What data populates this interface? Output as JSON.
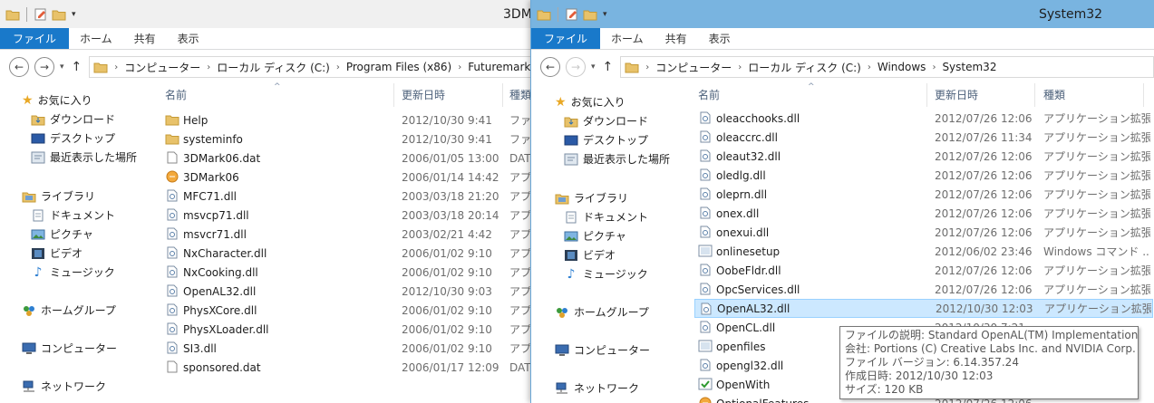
{
  "left_window": {
    "title": "3DM",
    "ribbon_tabs": [
      "ファイル",
      "ホーム",
      "共有",
      "表示"
    ],
    "breadcrumb": [
      "コンピューター",
      "ローカル ディスク (C:)",
      "Program Files (x86)",
      "Futuremark"
    ],
    "columns": {
      "name": "名前",
      "date": "更新日時",
      "type": "種類"
    },
    "nav": {
      "favorites": "お気に入り",
      "downloads": "ダウンロード",
      "desktop": "デスクトップ",
      "recent": "最近表示した場所",
      "libraries": "ライブラリ",
      "documents": "ドキュメント",
      "pictures": "ピクチャ",
      "videos": "ビデオ",
      "music": "ミュージック",
      "homegroup": "ホームグループ",
      "computer": "コンピューター",
      "network": "ネットワーク"
    },
    "files": [
      {
        "name": "Help",
        "date": "2012/10/30 9:41",
        "type": "ファイ",
        "icon": "folder"
      },
      {
        "name": "systeminfo",
        "date": "2012/10/30 9:41",
        "type": "ファイ",
        "icon": "folder"
      },
      {
        "name": "3DMark06.dat",
        "date": "2006/01/05 13:00",
        "type": "DAT",
        "icon": "file"
      },
      {
        "name": "3DMark06",
        "date": "2006/01/14 14:42",
        "type": "アプリ",
        "icon": "app"
      },
      {
        "name": "MFC71.dll",
        "date": "2003/03/18 21:20",
        "type": "アプリ",
        "icon": "dll"
      },
      {
        "name": "msvcp71.dll",
        "date": "2003/03/18 20:14",
        "type": "アプリ",
        "icon": "dll"
      },
      {
        "name": "msvcr71.dll",
        "date": "2003/02/21 4:42",
        "type": "アプリ",
        "icon": "dll"
      },
      {
        "name": "NxCharacter.dll",
        "date": "2006/01/02 9:10",
        "type": "アプリ",
        "icon": "dll"
      },
      {
        "name": "NxCooking.dll",
        "date": "2006/01/02 9:10",
        "type": "アプリ",
        "icon": "dll"
      },
      {
        "name": "OpenAL32.dll",
        "date": "2012/10/30 9:03",
        "type": "アプリ",
        "icon": "dll"
      },
      {
        "name": "PhysXCore.dll",
        "date": "2006/01/02 9:10",
        "type": "アプリ",
        "icon": "dll"
      },
      {
        "name": "PhysXLoader.dll",
        "date": "2006/01/02 9:10",
        "type": "アプリ",
        "icon": "dll"
      },
      {
        "name": "SI3.dll",
        "date": "2006/01/02 9:10",
        "type": "アプリ",
        "icon": "dll"
      },
      {
        "name": "sponsored.dat",
        "date": "2006/01/17 12:09",
        "type": "DAT",
        "icon": "file"
      }
    ]
  },
  "right_window": {
    "title": "System32",
    "ribbon_tabs": [
      "ファイル",
      "ホーム",
      "共有",
      "表示"
    ],
    "breadcrumb": [
      "コンピューター",
      "ローカル ディスク (C:)",
      "Windows",
      "System32"
    ],
    "columns": {
      "name": "名前",
      "date": "更新日時",
      "type": "種類"
    },
    "nav": {
      "favorites": "お気に入り",
      "downloads": "ダウンロード",
      "desktop": "デスクトップ",
      "recent": "最近表示した場所",
      "libraries": "ライブラリ",
      "documents": "ドキュメント",
      "pictures": "ピクチャ",
      "videos": "ビデオ",
      "music": "ミュージック",
      "homegroup": "ホームグループ",
      "computer": "コンピューター",
      "network": "ネットワーク"
    },
    "files": [
      {
        "name": "oleacchooks.dll",
        "date": "2012/07/26 12:06",
        "type": "アプリケーション拡張",
        "icon": "dll"
      },
      {
        "name": "oleaccrc.dll",
        "date": "2012/07/26 11:34",
        "type": "アプリケーション拡張",
        "icon": "dll"
      },
      {
        "name": "oleaut32.dll",
        "date": "2012/07/26 12:06",
        "type": "アプリケーション拡張",
        "icon": "dll"
      },
      {
        "name": "oledlg.dll",
        "date": "2012/07/26 12:06",
        "type": "アプリケーション拡張",
        "icon": "dll"
      },
      {
        "name": "oleprn.dll",
        "date": "2012/07/26 12:06",
        "type": "アプリケーション拡張",
        "icon": "dll"
      },
      {
        "name": "onex.dll",
        "date": "2012/07/26 12:06",
        "type": "アプリケーション拡張",
        "icon": "dll"
      },
      {
        "name": "onexui.dll",
        "date": "2012/07/26 12:06",
        "type": "アプリケーション拡張",
        "icon": "dll"
      },
      {
        "name": "onlinesetup",
        "date": "2012/06/02 23:46",
        "type": "Windows コマンド ...",
        "icon": "cmd"
      },
      {
        "name": "OobeFldr.dll",
        "date": "2012/07/26 12:06",
        "type": "アプリケーション拡張",
        "icon": "dll"
      },
      {
        "name": "OpcServices.dll",
        "date": "2012/07/26 12:06",
        "type": "アプリケーション拡張",
        "icon": "dll"
      },
      {
        "name": "OpenAL32.dll",
        "date": "2012/10/30 12:03",
        "type": "アプリケーション拡張",
        "icon": "dll",
        "selected": true
      },
      {
        "name": "OpenCL.dll",
        "date": "2012/10/30 7:21",
        "type": "",
        "icon": "dll"
      },
      {
        "name": "openfiles",
        "date": "",
        "type": "",
        "icon": "cmd"
      },
      {
        "name": "opengl32.dll",
        "date": "",
        "type": "",
        "icon": "dll"
      },
      {
        "name": "OpenWith",
        "date": "",
        "type": "",
        "icon": "openwith"
      },
      {
        "name": "OptionalFeatures",
        "date": "2012/07/26 12:06",
        "type": "",
        "icon": "app"
      }
    ]
  },
  "tooltip": {
    "line1": "ファイルの説明: Standard OpenAL(TM) Implementation",
    "line2": "会社: Portions (C) Creative Labs Inc. and NVIDIA Corp.",
    "line3": "ファイル バージョン: 6.14.357.24",
    "line4": "作成日時: 2012/10/30 12:03",
    "line5": "サイズ: 120 KB"
  },
  "colors": {
    "accent": "#1979ca",
    "active_title": "#79b4e0",
    "selection": "#cce8ff"
  }
}
